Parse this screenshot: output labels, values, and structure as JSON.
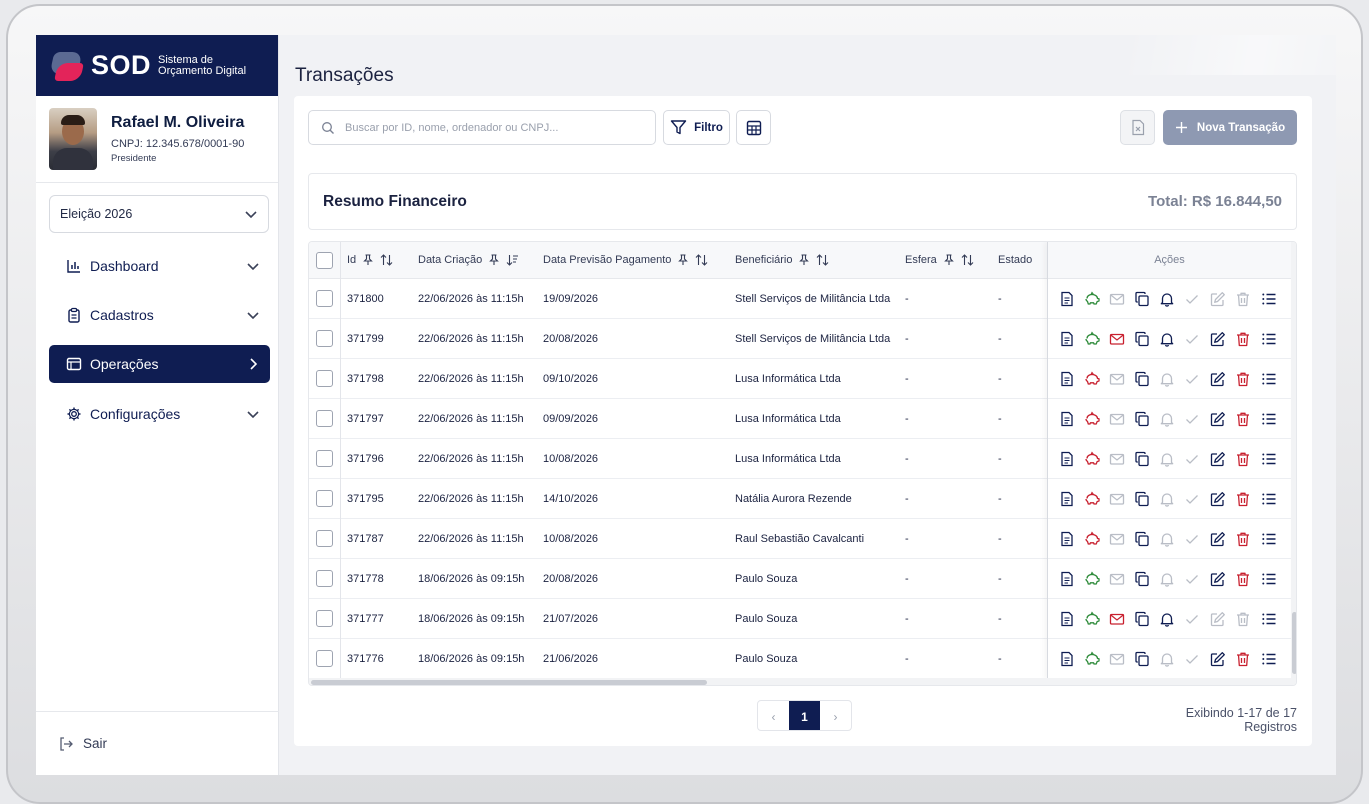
{
  "brand": {
    "name": "SOD",
    "subtitle_line1": "Sistema de",
    "subtitle_line2": "Orçamento Digital"
  },
  "profile": {
    "name": "Rafael M. Oliveira",
    "cnpj": "CNPJ: 12.345.678/0001-90",
    "role": "Presidente"
  },
  "election_select": {
    "value": "Eleição 2026"
  },
  "nav": [
    {
      "label": "Dashboard",
      "icon": "bar-chart-icon",
      "active": false
    },
    {
      "label": "Cadastros",
      "icon": "clipboard-icon",
      "active": false
    },
    {
      "label": "Operações",
      "icon": "window-icon",
      "active": true
    },
    {
      "label": "Configurações",
      "icon": "gear-icon",
      "active": false
    }
  ],
  "logout_label": "Sair",
  "page_title": "Transações",
  "toolbar": {
    "search_placeholder": "Buscar por ID, nome, ordenador ou CNPJ...",
    "filter_label": "Filtro",
    "new_label": "Nova Transação"
  },
  "summary": {
    "title": "Resumo Financeiro",
    "total": "Total: R$ 16.844,50"
  },
  "table": {
    "columns": [
      "Id",
      "Data Criação",
      "Data Previsão Pagamento",
      "Beneficiário",
      "Esfera",
      "Estado"
    ],
    "actions_header": "Ações",
    "rows": [
      {
        "id": "371800",
        "created": "22/06/2026 às 11:15h",
        "due": "19/09/2026",
        "beneficiary": "Stell Serviços de Militância Ltda",
        "sphere": "-",
        "state": "-"
      },
      {
        "id": "371799",
        "created": "22/06/2026 às 11:15h",
        "due": "20/08/2026",
        "beneficiary": "Stell Serviços de Militância Ltda",
        "sphere": "-",
        "state": "-"
      },
      {
        "id": "371798",
        "created": "22/06/2026 às 11:15h",
        "due": "09/10/2026",
        "beneficiary": "Lusa Informática Ltda",
        "sphere": "-",
        "state": "-"
      },
      {
        "id": "371797",
        "created": "22/06/2026 às 11:15h",
        "due": "09/09/2026",
        "beneficiary": "Lusa Informática Ltda",
        "sphere": "-",
        "state": "-"
      },
      {
        "id": "371796",
        "created": "22/06/2026 às 11:15h",
        "due": "10/08/2026",
        "beneficiary": "Lusa Informática Ltda",
        "sphere": "-",
        "state": "-"
      },
      {
        "id": "371795",
        "created": "22/06/2026 às 11:15h",
        "due": "14/10/2026",
        "beneficiary": "Natália Aurora Rezende",
        "sphere": "-",
        "state": "-"
      },
      {
        "id": "371787",
        "created": "22/06/2026 às 11:15h",
        "due": "10/08/2026",
        "beneficiary": "Raul Sebastião Cavalcanti",
        "sphere": "-",
        "state": "-"
      },
      {
        "id": "371778",
        "created": "18/06/2026 às 09:15h",
        "due": "20/08/2026",
        "beneficiary": "Paulo Souza",
        "sphere": "-",
        "state": "-"
      },
      {
        "id": "371777",
        "created": "18/06/2026 às 09:15h",
        "due": "21/07/2026",
        "beneficiary": "Paulo Souza",
        "sphere": "-",
        "state": "-"
      },
      {
        "id": "371776",
        "created": "18/06/2026 às 09:15h",
        "due": "21/06/2026",
        "beneficiary": "Paulo Souza",
        "sphere": "-",
        "state": "-"
      }
    ]
  },
  "row_actions": {
    "icons": [
      "document-icon",
      "piggy-bank-icon",
      "mail-icon",
      "copy-icon",
      "bell-icon",
      "check-icon",
      "edit-icon",
      "trash-icon",
      "list-icon"
    ],
    "states": [
      {
        "piggy": "green",
        "mail": "muted",
        "bell": "dark",
        "edit": "muted",
        "trash": "muted"
      },
      {
        "piggy": "green",
        "mail": "red",
        "bell": "dark",
        "edit": "dark",
        "trash": "red"
      },
      {
        "piggy": "red",
        "mail": "muted",
        "bell": "muted",
        "edit": "dark",
        "trash": "red"
      },
      {
        "piggy": "red",
        "mail": "muted",
        "bell": "muted",
        "edit": "dark",
        "trash": "red"
      },
      {
        "piggy": "red",
        "mail": "muted",
        "bell": "muted",
        "edit": "dark",
        "trash": "red"
      },
      {
        "piggy": "red",
        "mail": "muted",
        "bell": "muted",
        "edit": "dark",
        "trash": "red"
      },
      {
        "piggy": "red",
        "mail": "muted",
        "bell": "muted",
        "edit": "dark",
        "trash": "red"
      },
      {
        "piggy": "green",
        "mail": "muted",
        "bell": "muted",
        "edit": "dark",
        "trash": "red"
      },
      {
        "piggy": "green",
        "mail": "red",
        "bell": "dark",
        "edit": "muted",
        "trash": "muted"
      },
      {
        "piggy": "green",
        "mail": "muted",
        "bell": "muted",
        "edit": "dark",
        "trash": "red"
      }
    ]
  },
  "pagination": {
    "prev": "‹",
    "current": "1",
    "next": "›",
    "summary": "Exibindo 1-17 de 17 Registros"
  },
  "colors": {
    "navy": "#0f1d52",
    "green": "#2e8b3a",
    "red": "#c8202f",
    "muted": "#b9bdc6",
    "accent_pink": "#e3245a"
  }
}
